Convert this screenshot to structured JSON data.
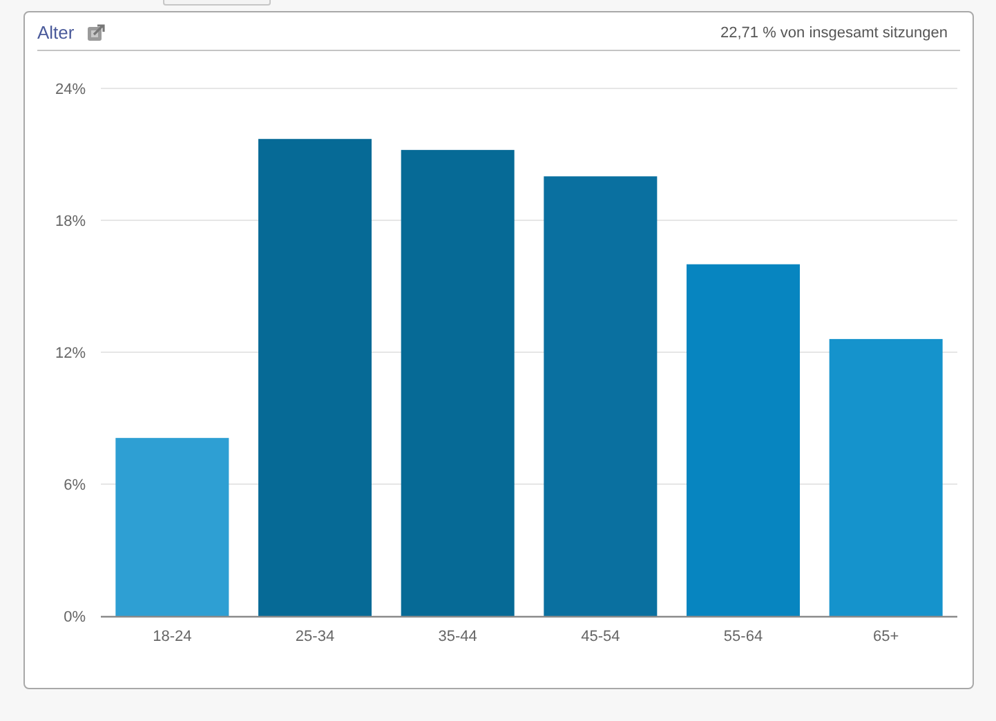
{
  "panel": {
    "title": "Alter",
    "summary": "22,71 % von insgesamt sitzungen",
    "chart_data": {
      "type": "bar",
      "categories": [
        "18-24",
        "25-34",
        "35-44",
        "45-54",
        "55-64",
        "65+"
      ],
      "stacked": true,
      "grid": true,
      "series": [
        {
          "color": "#2e9fd3",
          "values": [
            8.1,
            null,
            null,
            null,
            null,
            null
          ]
        },
        {
          "color": "#066a96",
          "values": [
            null,
            21.7,
            null,
            null,
            null,
            null
          ]
        },
        {
          "color": "#066a96",
          "values": [
            null,
            null,
            21.2,
            null,
            null,
            null
          ]
        },
        {
          "color": "#0a70a0",
          "values": [
            null,
            null,
            null,
            20.0,
            null,
            null
          ]
        },
        {
          "color": "#0785c0",
          "values": [
            null,
            null,
            null,
            null,
            16.0,
            null
          ]
        },
        {
          "color": "#1593cc",
          "values": [
            null,
            null,
            null,
            null,
            null,
            12.6
          ]
        }
      ],
      "ylim": [
        0,
        24
      ],
      "yticks": [
        {
          "value": 0,
          "label": "0%"
        },
        {
          "value": 6,
          "label": "6%"
        },
        {
          "value": 12,
          "label": "12%"
        },
        {
          "value": 18,
          "label": "18%"
        },
        {
          "value": 24,
          "label": "24%"
        }
      ]
    }
  }
}
